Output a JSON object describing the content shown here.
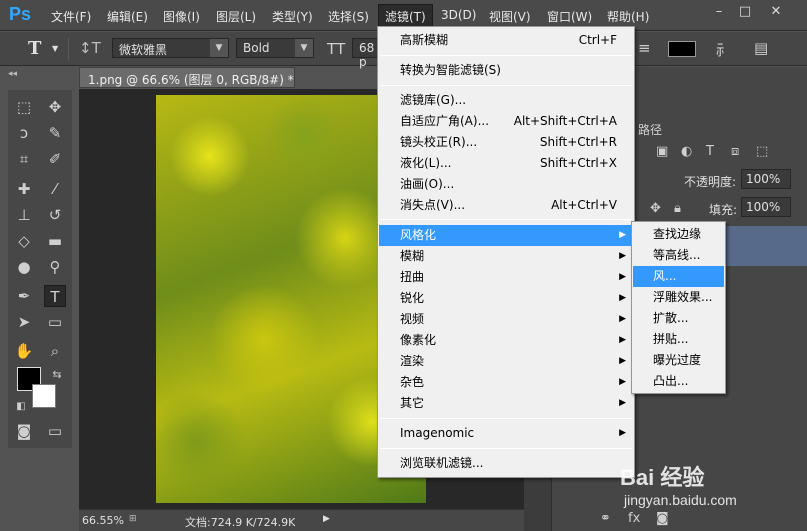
{
  "app": {
    "logo": "Ps"
  },
  "menubar": {
    "items": [
      {
        "label": "文件(F)",
        "active": false
      },
      {
        "label": "编辑(E)",
        "active": false
      },
      {
        "label": "图像(I)",
        "active": false
      },
      {
        "label": "图层(L)",
        "active": false
      },
      {
        "label": "类型(Y)",
        "active": false
      },
      {
        "label": "选择(S)",
        "active": false
      },
      {
        "label": "滤镜(T)",
        "active": true
      },
      {
        "label": "3D(D)",
        "active": false
      },
      {
        "label": "视图(V)",
        "active": false
      },
      {
        "label": "窗口(W)",
        "active": false
      },
      {
        "label": "帮助(H)",
        "active": false
      }
    ],
    "window_controls": [
      "–",
      "□",
      "✕"
    ]
  },
  "options_bar": {
    "tool_glyph": "T",
    "font_family": "微软雅黑",
    "font_style": "Bold",
    "font_size": "68 p"
  },
  "document": {
    "tab_title": "1.png @ 66.6% (图层 0, RGB/8#) *",
    "tab_close": "×",
    "zoom": "66.55%",
    "doc_size": "文档:724.9 K/724.9K"
  },
  "right_panel": {
    "paths_tab": "路径",
    "opacity_label": "不透明度:",
    "opacity_value": "100%",
    "fill_label": "填充:",
    "fill_value": "100%"
  },
  "filter_menu": {
    "items": [
      {
        "label": "高斯模糊",
        "shortcut": "Ctrl+F",
        "submenu": false,
        "highlighted": false
      },
      {
        "label": "转换为智能滤镜(S)",
        "shortcut": "",
        "submenu": false,
        "highlighted": false
      },
      {
        "label": "滤镜库(G)...",
        "shortcut": "",
        "submenu": false,
        "highlighted": false
      },
      {
        "label": "自适应广角(A)...",
        "shortcut": "Alt+Shift+Ctrl+A",
        "submenu": false,
        "highlighted": false
      },
      {
        "label": "镜头校正(R)...",
        "shortcut": "Shift+Ctrl+R",
        "submenu": false,
        "highlighted": false
      },
      {
        "label": "液化(L)...",
        "shortcut": "Shift+Ctrl+X",
        "submenu": false,
        "highlighted": false
      },
      {
        "label": "油画(O)...",
        "shortcut": "",
        "submenu": false,
        "highlighted": false
      },
      {
        "label": "消失点(V)...",
        "shortcut": "Alt+Ctrl+V",
        "submenu": false,
        "highlighted": false
      },
      {
        "label": "风格化",
        "shortcut": "",
        "submenu": true,
        "highlighted": true
      },
      {
        "label": "模糊",
        "shortcut": "",
        "submenu": true,
        "highlighted": false
      },
      {
        "label": "扭曲",
        "shortcut": "",
        "submenu": true,
        "highlighted": false
      },
      {
        "label": "锐化",
        "shortcut": "",
        "submenu": true,
        "highlighted": false
      },
      {
        "label": "视频",
        "shortcut": "",
        "submenu": true,
        "highlighted": false
      },
      {
        "label": "像素化",
        "shortcut": "",
        "submenu": true,
        "highlighted": false
      },
      {
        "label": "渲染",
        "shortcut": "",
        "submenu": true,
        "highlighted": false
      },
      {
        "label": "杂色",
        "shortcut": "",
        "submenu": true,
        "highlighted": false
      },
      {
        "label": "其它",
        "shortcut": "",
        "submenu": true,
        "highlighted": false
      },
      {
        "label": "Imagenomic",
        "shortcut": "",
        "submenu": true,
        "highlighted": false
      },
      {
        "label": "浏览联机滤镜...",
        "shortcut": "",
        "submenu": false,
        "highlighted": false
      }
    ]
  },
  "stylize_submenu": {
    "items": [
      {
        "label": "查找边缘",
        "highlighted": false
      },
      {
        "label": "等高线...",
        "highlighted": false
      },
      {
        "label": "风...",
        "highlighted": true
      },
      {
        "label": "浮雕效果...",
        "highlighted": false
      },
      {
        "label": "扩散...",
        "highlighted": false
      },
      {
        "label": "拼贴...",
        "highlighted": false
      },
      {
        "label": "曝光过度",
        "highlighted": false
      },
      {
        "label": "凸出...",
        "highlighted": false
      }
    ]
  },
  "watermark": {
    "brand": "Bai 经验",
    "url": "jingyan.baidu.com"
  },
  "colors": {
    "menu_highlight": "#3399ff",
    "menu_bg": "#f0f0f0",
    "ui_dark": "#535353",
    "foreground": "#000000",
    "background": "#ffffff"
  },
  "icons": {
    "tools": [
      "marquee-icon",
      "move-icon",
      "lasso-icon",
      "quick-select-icon",
      "crop-icon",
      "eyedropper-icon",
      "healing-brush-icon",
      "brush-icon",
      "clone-stamp-icon",
      "history-brush-icon",
      "eraser-icon",
      "gradient-icon",
      "blur-icon",
      "dodge-icon",
      "pen-icon",
      "type-icon",
      "path-select-icon",
      "rectangle-icon",
      "hand-icon",
      "zoom-icon"
    ]
  }
}
